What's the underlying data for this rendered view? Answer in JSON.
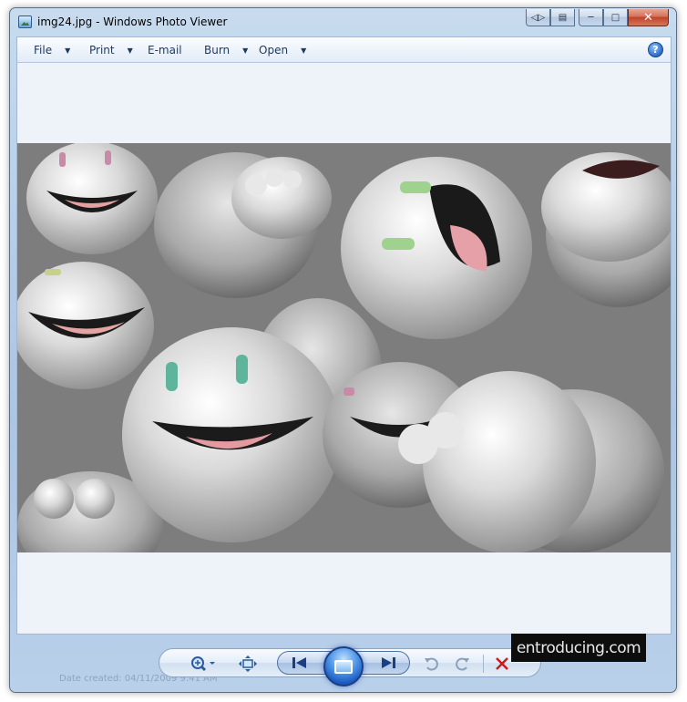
{
  "window": {
    "title": "img24.jpg - Windows Photo Viewer"
  },
  "menu": {
    "items": [
      {
        "label": "File"
      },
      {
        "label": "Print"
      },
      {
        "label": "E-mail"
      },
      {
        "label": "Burn"
      },
      {
        "label": "Open"
      }
    ],
    "help_glyph": "?"
  },
  "photo": {
    "alt": "img24.jpg"
  },
  "toolbar": {
    "date_text": "Date created: 04/11/2009 9:41 AM",
    "icons": [
      "zoom-icon",
      "actual-size-icon",
      "previous-icon",
      "slideshow-icon",
      "next-icon",
      "rotate-counterclockwise-icon",
      "rotate-clockwise-icon",
      "delete-icon"
    ]
  },
  "watermark": {
    "text": "entroducing.com"
  },
  "colors": {
    "frame": "#b7cfe8",
    "close": "#c14328",
    "accent": "#1d5bc1",
    "delete": "#cc1b1b"
  }
}
